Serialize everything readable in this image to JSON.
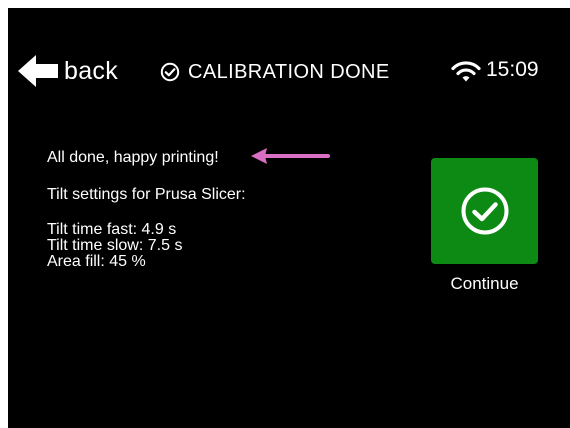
{
  "header": {
    "back_label": "back",
    "title": "CALIBRATION DONE",
    "time": "15:09"
  },
  "content": {
    "lines": [
      "All done, happy printing!",
      "Tilt settings for Prusa Slicer:",
      "Tilt time fast: 4.9 s",
      "Tilt time slow: 7.5 s",
      "Area fill: 45 %"
    ]
  },
  "continue_button": {
    "label": "Continue"
  },
  "icons": {
    "back": "arrow-left-icon",
    "title": "check-circle-icon",
    "status": "wifi-icon",
    "continue": "check-circle-icon",
    "annotation": "arrow-left-annotation-icon"
  },
  "colors": {
    "screen_background": "#000000",
    "text": "#ffffff",
    "continue_button": "#0d8a14",
    "annotation_arrow": "#d86fc2"
  }
}
